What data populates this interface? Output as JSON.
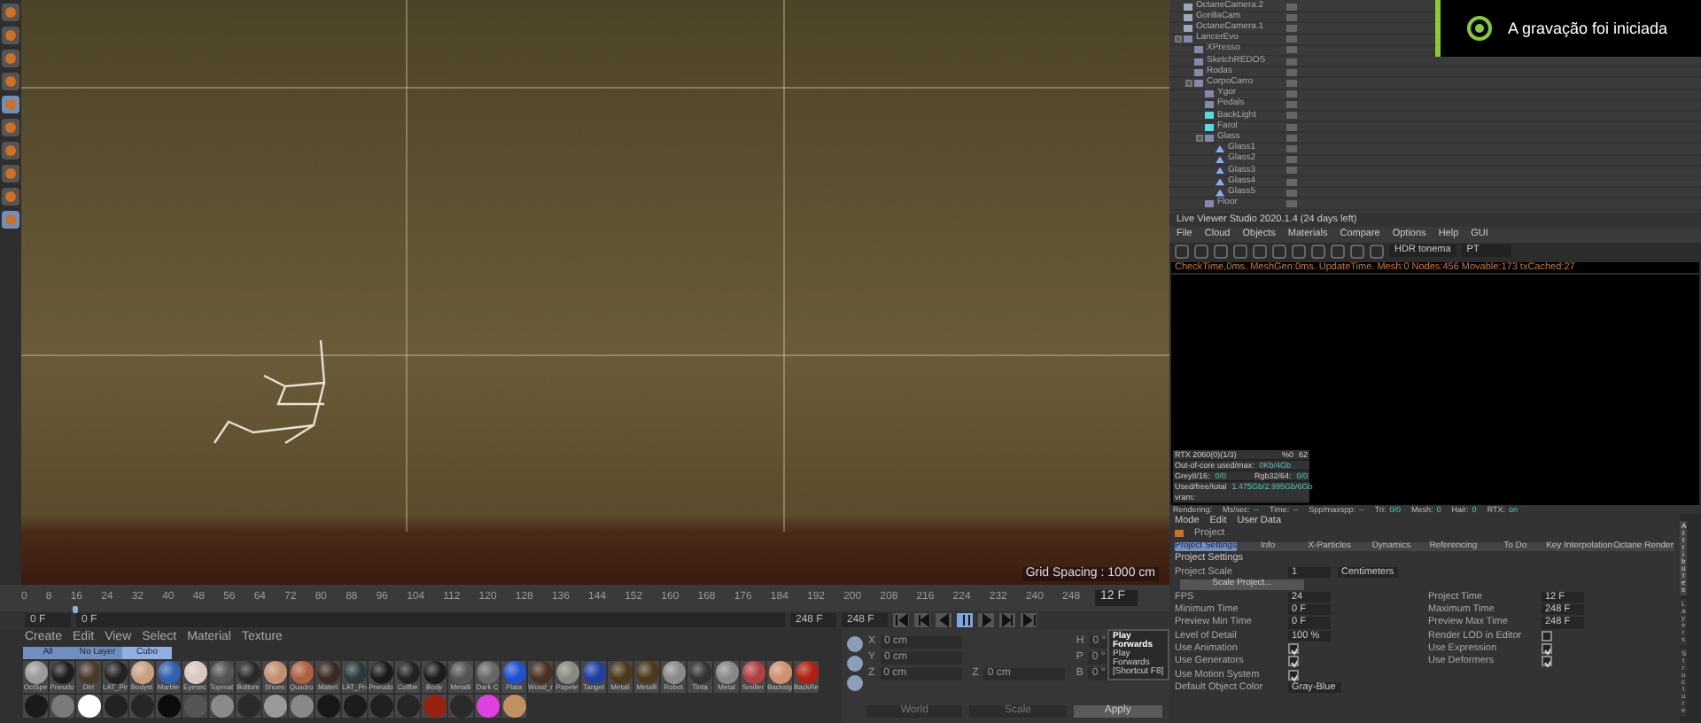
{
  "left_toolbar": {
    "tools": [
      {
        "selected": false
      },
      {
        "selected": false
      },
      {
        "selected": false
      },
      {
        "selected": false
      },
      {
        "selected": true
      },
      {
        "selected": false
      },
      {
        "selected": false
      },
      {
        "selected": false
      },
      {
        "selected": false
      },
      {
        "selected": true
      }
    ]
  },
  "viewport": {
    "grid_spacing": "Grid Spacing : 1000 cm"
  },
  "timeline": {
    "ticks": [
      "0",
      "8",
      "16",
      "24",
      "32",
      "40",
      "48",
      "56",
      "64",
      "72",
      "80",
      "88",
      "96",
      "104",
      "112",
      "120",
      "128",
      "136",
      "144",
      "152",
      "160",
      "168",
      "176",
      "184",
      "192",
      "200",
      "208",
      "216",
      "224",
      "232",
      "240",
      "248"
    ],
    "level": 0.048,
    "current_frame": "12 F"
  },
  "range_bar": {
    "start": "0 F",
    "range_start": "0 F",
    "range_end": "248 F",
    "end": "248 F"
  },
  "transport": [
    {
      "kind": "first",
      "selected": false
    },
    {
      "kind": "prev-key",
      "selected": false
    },
    {
      "kind": "back",
      "selected": false
    },
    {
      "kind": "play",
      "selected": true
    },
    {
      "kind": "forward",
      "selected": false
    },
    {
      "kind": "next-key",
      "selected": false
    },
    {
      "kind": "last",
      "selected": false
    }
  ],
  "material_manager": {
    "menu": [
      "Create",
      "Edit",
      "View",
      "Select",
      "Material",
      "Texture"
    ],
    "tabs": [
      {
        "label": "All",
        "selected": false
      },
      {
        "label": "No Layer",
        "selected": false
      },
      {
        "label": "Cubo",
        "selected": true
      }
    ],
    "materials": [
      {
        "name": "OctSpe",
        "color": "#9a9a9a"
      },
      {
        "name": "Pneudo",
        "color": "#1e1e1e"
      },
      {
        "name": "Dirt",
        "color": "#4a3a2e"
      },
      {
        "name": "LAT_Pir",
        "color": "#222222"
      },
      {
        "name": "Bodyst",
        "color": "#c8a080"
      },
      {
        "name": "Marble",
        "color": "#3060b0"
      },
      {
        "name": "Eyesec",
        "color": "#d8c8c0"
      },
      {
        "name": "Topmat",
        "color": "#555555"
      },
      {
        "name": "Bottom",
        "color": "#2a2a2a"
      },
      {
        "name": "Shoes",
        "color": "#c09070"
      },
      {
        "name": "Quadro",
        "color": "#b06040"
      },
      {
        "name": "Materi",
        "color": "#3a2a22"
      },
      {
        "name": "LAT_Pn",
        "color": "#2a3a3a"
      },
      {
        "name": "Pneudo",
        "color": "#1a1a1a"
      },
      {
        "name": "Colfbe",
        "color": "#222222"
      },
      {
        "name": "Body",
        "color": "#1c1c1c"
      },
      {
        "name": "Metalli",
        "color": "#555555"
      },
      {
        "name": "Dark C",
        "color": "#666666"
      },
      {
        "name": "Plata",
        "color": "#2050d0"
      },
      {
        "name": "Wood_r",
        "color": "#4a3020"
      },
      {
        "name": "Papele",
        "color": "#888880"
      },
      {
        "name": "Tangel",
        "color": "#2040a0"
      },
      {
        "name": "Metali",
        "color": "#4a3a1a"
      },
      {
        "name": "Metalli",
        "color": "#4a3a1a"
      },
      {
        "name": "Robot",
        "color": "#8a8a8a"
      },
      {
        "name": "Tinta",
        "color": "#333333"
      },
      {
        "name": "Metal",
        "color": "#888888"
      },
      {
        "name": "Smiller",
        "color": "#b04040"
      },
      {
        "name": "Backsig",
        "color": "#d09070"
      },
      {
        "name": "BackRe",
        "color": "#b02010"
      }
    ],
    "second_row": [
      {
        "color": "#1a1a1a"
      },
      {
        "color": "#7a7a7a"
      },
      {
        "color": "#ffffff"
      },
      {
        "color": "#222222"
      },
      {
        "color": "#262626"
      },
      {
        "color": "#0c0c0c"
      },
      {
        "color": "#555555"
      },
      {
        "color": "#8a8a8a"
      },
      {
        "color": "#2a2a2a"
      },
      {
        "color": "#999999"
      },
      {
        "color": "#888888"
      },
      {
        "color": "#181818"
      },
      {
        "color": "#1c1c1c"
      },
      {
        "color": "#202020"
      },
      {
        "color": "#262626"
      },
      {
        "color": "#9a2010"
      },
      {
        "color": "#2a2a2a"
      },
      {
        "color": "#e040e0"
      },
      {
        "color": "#c09060"
      }
    ]
  },
  "coordinates": {
    "position": [
      {
        "axis": "X",
        "value": "0 cm"
      },
      {
        "axis": "Y",
        "value": "0 cm"
      },
      {
        "axis": "Z",
        "value": "0 cm"
      }
    ],
    "size": [
      {
        "axis": "Z",
        "value": "0 cm"
      }
    ],
    "rotation": [
      {
        "axis": "H",
        "value": "0 °"
      },
      {
        "axis": "P",
        "value": "0 °"
      },
      {
        "axis": "B",
        "value": "0 °"
      }
    ],
    "mode": "World",
    "size_mode": "Scale",
    "apply": "Apply"
  },
  "tooltip": {
    "title": "Play Forwards",
    "lines": [
      "Play Forwards",
      "[Shortcut F8]"
    ]
  },
  "object_manager": {
    "objects": [
      {
        "name": "OctaneCamera.2",
        "kind": "camera"
      },
      {
        "name": "GorillaCam",
        "kind": "camera"
      },
      {
        "name": "OctaneCamera.1",
        "kind": "camera"
      },
      {
        "name": "LancerEvo",
        "kind": "null",
        "expanded": true,
        "children": [
          {
            "name": "XPresso",
            "kind": "null"
          },
          {
            "name": "SketchREDOS",
            "kind": "null"
          },
          {
            "name": "Rodas",
            "kind": "null"
          },
          {
            "name": "CorpoCarro",
            "kind": "null",
            "expanded": true,
            "children": [
              {
                "name": "Ygor",
                "kind": "null"
              },
              {
                "name": "Pedals",
                "kind": "null"
              },
              {
                "name": "BackLight",
                "kind": "light"
              },
              {
                "name": "Farol",
                "kind": "light"
              },
              {
                "name": "Glass",
                "kind": "null",
                "expanded": true,
                "children": [
                  {
                    "name": "Glass1",
                    "kind": "mesh"
                  },
                  {
                    "name": "Glass2",
                    "kind": "mesh"
                  },
                  {
                    "name": "Glass3",
                    "kind": "mesh"
                  },
                  {
                    "name": "Glass4",
                    "kind": "mesh"
                  },
                  {
                    "name": "Glass5",
                    "kind": "mesh"
                  }
                ]
              },
              {
                "name": "Floor",
                "kind": "null"
              }
            ]
          }
        ]
      }
    ]
  },
  "notification": {
    "text": "A gravação foi iniciada"
  },
  "live_viewer": {
    "title": "Live Viewer Studio 2020.1.4 (24 days left)",
    "menu": [
      "File",
      "Cloud",
      "Objects",
      "Materials",
      "Compare",
      "Options",
      "Help",
      "GUI"
    ],
    "tonemap": "HDR tonema",
    "kernel": "PT",
    "status": "CheckTime,0ms. MeshGen:0ms. UpdateTime. Mesh:0 Nodes:456 Movable:173 txCached:27",
    "gpu": {
      "name": "RTX 2060(0)(1/3)",
      "percent": "%0",
      "temp": "62"
    },
    "stats": [
      {
        "label": "Out-of-core used/max:",
        "value": "0Kb/4Gb"
      },
      {
        "label": "Grey8/16:",
        "value": "0/0",
        "label2": "Rgb32/64:",
        "value2": "0/0"
      },
      {
        "label": "Used/free/total vram:",
        "value": "1.475Gb/2.995Gb/6Gb"
      }
    ],
    "render_status": [
      {
        "label": "Rendering:"
      },
      {
        "label": "Ms/sec:",
        "value": "--"
      },
      {
        "label": "Time:",
        "value": "--"
      },
      {
        "label": "Spp/maxspp:",
        "value": "--"
      },
      {
        "label": "Tri:",
        "value": "0/0"
      },
      {
        "label": "Mesh:",
        "value": "0"
      },
      {
        "label": "Hair:",
        "value": "0"
      },
      {
        "label": "RTX:",
        "value": "on"
      }
    ]
  },
  "attributes": {
    "menu": [
      "Mode",
      "Edit",
      "User Data"
    ],
    "object": "Project",
    "tabs": [
      {
        "label": "Project Settings",
        "selected": true
      },
      {
        "label": "Info",
        "selected": false
      },
      {
        "label": "X-Particles",
        "selected": false
      },
      {
        "label": "Dynamics",
        "selected": false
      },
      {
        "label": "Referencing",
        "selected": false
      },
      {
        "label": "To Do",
        "selected": false
      },
      {
        "label": "Key Interpolation",
        "selected": false
      },
      {
        "label": "Octane Render",
        "selected": false
      }
    ],
    "section": "Project Settings",
    "project_scale": {
      "label": "Project Scale",
      "value": "1",
      "unit": "Centimeters"
    },
    "scale_button": "Scale Project...",
    "fields": [
      {
        "label": "FPS",
        "value": "24"
      },
      {
        "label": "Project Time",
        "value": "12 F"
      },
      {
        "label": "Minimum Time",
        "value": "0 F"
      },
      {
        "label": "Maximum Time",
        "value": "248 F"
      },
      {
        "label": "Preview Min Time",
        "value": "0 F"
      },
      {
        "label": "Preview Max Time",
        "value": "248 F"
      },
      {
        "label": "Level of Detail",
        "value": "100 %"
      }
    ],
    "checks": [
      {
        "label": "Render LOD in Editor",
        "checked": false
      },
      {
        "label": "Use Animation",
        "checked": true
      },
      {
        "label": "Use Expression",
        "checked": true
      },
      {
        "label": "Use Generators",
        "checked": true
      },
      {
        "label": "Use Deformers",
        "checked": true
      },
      {
        "label": "Use Motion System",
        "checked": true
      }
    ],
    "default_color": {
      "label": "Default Object Color",
      "value": "Gray-Blue"
    },
    "side_tabs": [
      {
        "label": "Attributes",
        "selected": true
      },
      {
        "label": "Layers",
        "selected": false
      },
      {
        "label": "Structure",
        "selected": false
      }
    ]
  }
}
